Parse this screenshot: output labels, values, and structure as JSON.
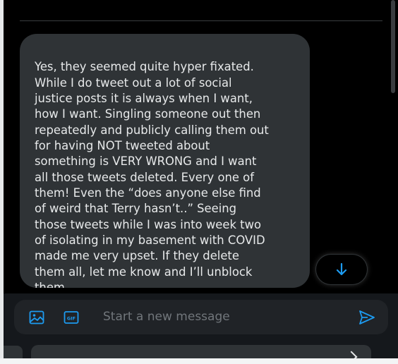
{
  "message": {
    "text": "Yes, they seemed quite hyper fixated.\nWhile I do tweet out a lot of social\njustice posts it is always when I want,\nhow I want. Singling someone out then\nrepeatedly and publicly calling them out\nfor having NOT tweeted about\nsomething is VERY WRONG and I want\nall those tweets deleted. Every one of\nthem! Even the “does anyone else find\nof weird that Terry hasn’t..” Seeing\nthose tweets while I was into week two\nof isolating in my basement with COVID\nmade me very upset. If they delete\nthem all, let me know and I’ll unblock\nthem."
  },
  "composer": {
    "placeholder": "Start a new message",
    "media_icon": "image-icon",
    "gif_icon": "gif-icon",
    "gif_label": "GIF",
    "send_icon": "send-icon"
  },
  "scroll_button": {
    "icon": "arrow-down-icon"
  },
  "colors": {
    "background": "#000000",
    "bubble": "#2f3336",
    "text": "#e7e9ea",
    "accent": "#1d9bf0",
    "placeholder": "#71767b",
    "composer": "#202327"
  }
}
